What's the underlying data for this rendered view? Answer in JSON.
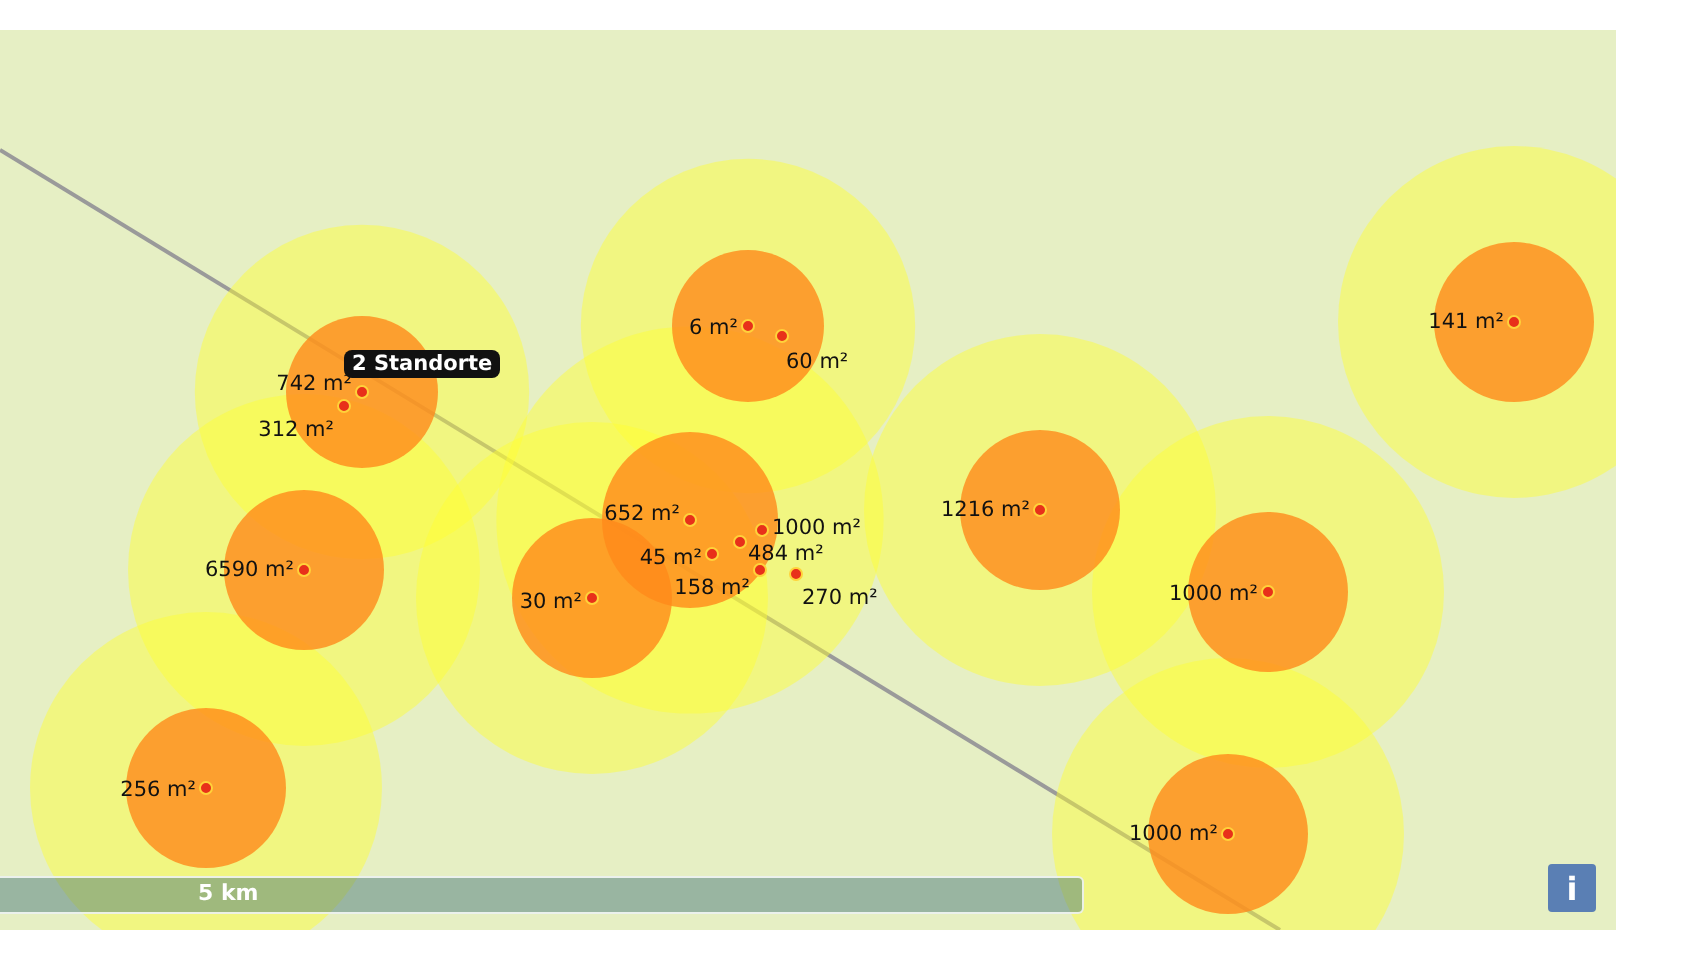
{
  "map": {
    "markers": [
      {
        "label": "6 m²"
      },
      {
        "label": "60 m²"
      },
      {
        "label": "742 m²"
      },
      {
        "label": "312 m²"
      },
      {
        "label": "6590 m²"
      },
      {
        "label": "256 m²"
      },
      {
        "label": "30 m²"
      },
      {
        "label": "652 m²"
      },
      {
        "label": "1000 m²"
      },
      {
        "label": "45 m²"
      },
      {
        "label": "484 m²"
      },
      {
        "label": "158 m²"
      },
      {
        "label": "270 m²"
      },
      {
        "label": "1216 m²"
      },
      {
        "label": "1000 m²"
      },
      {
        "label": "1000 m²"
      },
      {
        "label": "141 m²"
      }
    ],
    "cluster_tooltip": "2 Standorte",
    "scale_bar": {
      "label": "5 km"
    },
    "info_button": "i"
  }
}
